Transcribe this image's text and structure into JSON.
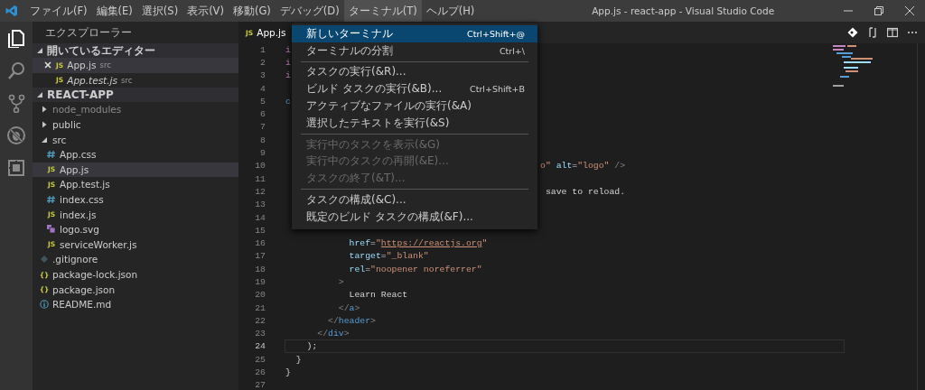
{
  "window": {
    "title": "App.js - react-app - Visual Studio Code"
  },
  "menu_bar": [
    {
      "label": "ファイル(F)",
      "selected": false
    },
    {
      "label": "編集(E)",
      "selected": false
    },
    {
      "label": "選択(S)",
      "selected": false
    },
    {
      "label": "表示(V)",
      "selected": false
    },
    {
      "label": "移動(G)",
      "selected": false
    },
    {
      "label": "デバッグ(D)",
      "selected": false
    },
    {
      "label": "ターミナル(T)",
      "selected": true
    },
    {
      "label": "ヘルプ(H)",
      "selected": false
    }
  ],
  "activity_bar": [
    {
      "kind": "explorer",
      "selected": true
    },
    {
      "kind": "search",
      "selected": false
    },
    {
      "kind": "scm",
      "selected": false
    },
    {
      "kind": "debug",
      "selected": false
    },
    {
      "kind": "extensions",
      "selected": false
    }
  ],
  "sidebar": {
    "title": "エクスプローラー",
    "open_editors": {
      "label": "開いているエディター",
      "expanded": true,
      "items": [
        {
          "icon": "JS",
          "name": "App.js",
          "folder": "src",
          "selected": true,
          "preview": false
        },
        {
          "icon": "JS",
          "name": "App.test.js",
          "folder": "src",
          "selected": false,
          "preview": true
        }
      ]
    },
    "project": {
      "label": "REACT-APP",
      "expanded": true,
      "items": [
        {
          "name": "node_modules",
          "kind": "folder",
          "expanded": false,
          "dimmed": true,
          "selected": false
        },
        {
          "name": "public",
          "kind": "folder",
          "expanded": false,
          "dimmed": false,
          "selected": false
        },
        {
          "name": "src",
          "kind": "folder",
          "expanded": true,
          "dimmed": false,
          "selected": false,
          "children": [
            {
              "name": "App.css",
              "kind": "stylesheet",
              "dimmed": false,
              "selected": false
            },
            {
              "icon": "JS",
              "name": "App.js",
              "kind": "script",
              "dimmed": false,
              "selected": true
            },
            {
              "icon": "JS",
              "name": "App.test.js",
              "kind": "script",
              "dimmed": false,
              "selected": false
            },
            {
              "name": "index.css",
              "kind": "stylesheet",
              "dimmed": false,
              "selected": false
            },
            {
              "icon": "JS",
              "name": "index.js",
              "kind": "script",
              "dimmed": false,
              "selected": false
            },
            {
              "name": "logo.svg",
              "kind": "image",
              "dimmed": false,
              "selected": false
            },
            {
              "icon": "JS",
              "name": "serviceWorker.js",
              "kind": "script",
              "dimmed": false,
              "selected": false
            }
          ]
        },
        {
          "name": ".gitignore",
          "kind": "config",
          "dimmed": false,
          "selected": false
        },
        {
          "icon": "{}",
          "name": "package-lock.json",
          "kind": "data",
          "dimmed": false,
          "selected": false
        },
        {
          "icon": "{}",
          "name": "package.json",
          "kind": "data",
          "dimmed": false,
          "selected": false
        },
        {
          "name": "README.md",
          "kind": "doc",
          "dimmed": false,
          "selected": false
        }
      ]
    }
  },
  "editor": {
    "tabs": [
      {
        "icon": "JS",
        "label": "App.js",
        "selected": true
      }
    ],
    "lines": [
      {
        "number": "1",
        "current": false,
        "segments": [
          {
            "text": "i",
            "kind": "keyword"
          }
        ]
      },
      {
        "number": "2",
        "current": false,
        "segments": [
          {
            "text": "i",
            "kind": "keyword"
          }
        ]
      },
      {
        "number": "3",
        "current": false,
        "segments": [
          {
            "text": "i",
            "kind": "keyword"
          }
        ]
      },
      {
        "number": "4",
        "current": false
      },
      {
        "number": "5",
        "current": false,
        "segments": [
          {
            "text": "c",
            "kind": "tag"
          }
        ]
      },
      {
        "number": "6",
        "current": false
      },
      {
        "number": "7",
        "current": false
      },
      {
        "number": "8",
        "current": false
      },
      {
        "number": "9",
        "current": false
      },
      {
        "number": "10",
        "current": false,
        "segments_after_menu": [
          {
            "text": "o\"",
            "kind": "string"
          },
          {
            "text": " alt",
            "kind": "attr"
          },
          {
            "text": "=",
            "kind": "text"
          },
          {
            "text": "\"logo\"",
            "kind": "string"
          },
          {
            "text": " />",
            "kind": "punct"
          }
        ]
      },
      {
        "number": "11",
        "current": false
      },
      {
        "number": "12",
        "current": false,
        "segments_after_menu": [
          {
            "text": " save to reload.",
            "kind": "text"
          }
        ]
      },
      {
        "number": "13",
        "current": false
      },
      {
        "number": "14",
        "current": false
      },
      {
        "number": "15",
        "current": false
      },
      {
        "number": "16",
        "current": false,
        "segments": [
          {
            "text": "            href",
            "kind": "attr"
          },
          {
            "text": "=",
            "kind": "text"
          },
          {
            "text": "\"",
            "kind": "string"
          },
          {
            "text": "https://reactjs.org",
            "kind": "link"
          },
          {
            "text": "\"",
            "kind": "string"
          }
        ]
      },
      {
        "number": "17",
        "current": false,
        "segments": [
          {
            "text": "            target",
            "kind": "attr"
          },
          {
            "text": "=",
            "kind": "text"
          },
          {
            "text": "\"_blank\"",
            "kind": "string"
          }
        ]
      },
      {
        "number": "18",
        "current": false,
        "segments": [
          {
            "text": "            rel",
            "kind": "attr"
          },
          {
            "text": "=",
            "kind": "text"
          },
          {
            "text": "\"noopener noreferrer\"",
            "kind": "string"
          }
        ]
      },
      {
        "number": "19",
        "current": false,
        "segments": [
          {
            "text": "          >",
            "kind": "punct"
          }
        ]
      },
      {
        "number": "20",
        "current": false,
        "segments": [
          {
            "text": "            Learn React",
            "kind": "text"
          }
        ]
      },
      {
        "number": "21",
        "current": false,
        "segments": [
          {
            "text": "          </",
            "kind": "punct"
          },
          {
            "text": "a",
            "kind": "tag"
          },
          {
            "text": ">",
            "kind": "punct"
          }
        ]
      },
      {
        "number": "22",
        "current": false,
        "segments": [
          {
            "text": "        </",
            "kind": "punct"
          },
          {
            "text": "header",
            "kind": "tag"
          },
          {
            "text": ">",
            "kind": "punct"
          }
        ]
      },
      {
        "number": "23",
        "current": false,
        "segments": [
          {
            "text": "      </",
            "kind": "punct"
          },
          {
            "text": "div",
            "kind": "tag"
          },
          {
            "text": ">",
            "kind": "punct"
          }
        ]
      },
      {
        "number": "24",
        "current": true,
        "segments": [
          {
            "text": "    );",
            "kind": "text"
          }
        ]
      },
      {
        "number": "25",
        "current": false,
        "segments": [
          {
            "text": "  }",
            "kind": "text"
          }
        ]
      },
      {
        "number": "26",
        "current": false,
        "segments": [
          {
            "text": "}",
            "kind": "text"
          }
        ]
      },
      {
        "number": "27",
        "current": false
      }
    ]
  },
  "terminal_menu": [
    {
      "kind": "item",
      "label": "新しいターミナル",
      "shortcut": "Ctrl+Shift+@",
      "disabled": false,
      "selected": true
    },
    {
      "kind": "item",
      "label": "ターミナルの分割",
      "shortcut": "Ctrl+\\",
      "disabled": false,
      "selected": false
    },
    {
      "kind": "separator"
    },
    {
      "kind": "item",
      "label": "タスクの実行(&R)...",
      "disabled": false,
      "selected": false
    },
    {
      "kind": "item",
      "label": "ビルド タスクの実行(&B)...",
      "shortcut": "Ctrl+Shift+B",
      "disabled": false,
      "selected": false
    },
    {
      "kind": "item",
      "label": "アクティブなファイルの実行(&A)",
      "disabled": false,
      "selected": false
    },
    {
      "kind": "item",
      "label": "選択したテキストを実行(&S)",
      "disabled": false,
      "selected": false
    },
    {
      "kind": "separator"
    },
    {
      "kind": "item",
      "label": "実行中のタスクを表示(&G)",
      "disabled": true,
      "selected": false
    },
    {
      "kind": "item",
      "label": "実行中のタスクの再開(&E)...",
      "disabled": true,
      "selected": false
    },
    {
      "kind": "item",
      "label": "タスクの終了(&T)...",
      "disabled": true,
      "selected": false
    },
    {
      "kind": "separator"
    },
    {
      "kind": "item",
      "label": "タスクの構成(&C)...",
      "disabled": false,
      "selected": false
    },
    {
      "kind": "item",
      "label": "既定のビルド タスクの構成(&F)...",
      "disabled": false,
      "selected": false
    }
  ]
}
